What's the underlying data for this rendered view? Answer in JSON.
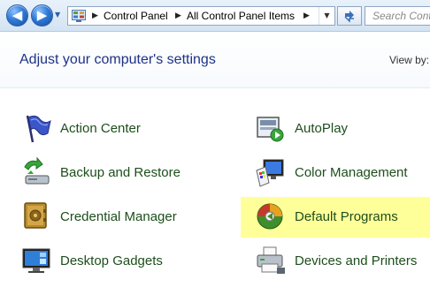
{
  "nav": {
    "back_glyph": "◀",
    "forward_glyph": "▶",
    "history_glyph": "▼"
  },
  "address": {
    "crumbs": [
      "Control Panel",
      "All Control Panel Items"
    ],
    "separator": "▶",
    "dropdown_glyph": "▼"
  },
  "search": {
    "placeholder": "Search Control Panel"
  },
  "page": {
    "title": "Adjust your computer's settings",
    "view_by_label": "View by:"
  },
  "items": [
    {
      "label": "Action Center",
      "icon": "flag-icon"
    },
    {
      "label": "AutoPlay",
      "icon": "autoplay-icon"
    },
    {
      "label": "Backup and Restore",
      "icon": "backup-icon"
    },
    {
      "label": "Color Management",
      "icon": "color-management-icon"
    },
    {
      "label": "Credential Manager",
      "icon": "vault-icon"
    },
    {
      "label": "Default Programs",
      "icon": "default-programs-icon",
      "highlighted": true
    },
    {
      "label": "Desktop Gadgets",
      "icon": "gadgets-icon"
    },
    {
      "label": "Devices and Printers",
      "icon": "printer-icon"
    }
  ],
  "colors": {
    "link_green": "#1d4e1b",
    "title_blue": "#1e3287",
    "highlight": "#ffff99"
  }
}
